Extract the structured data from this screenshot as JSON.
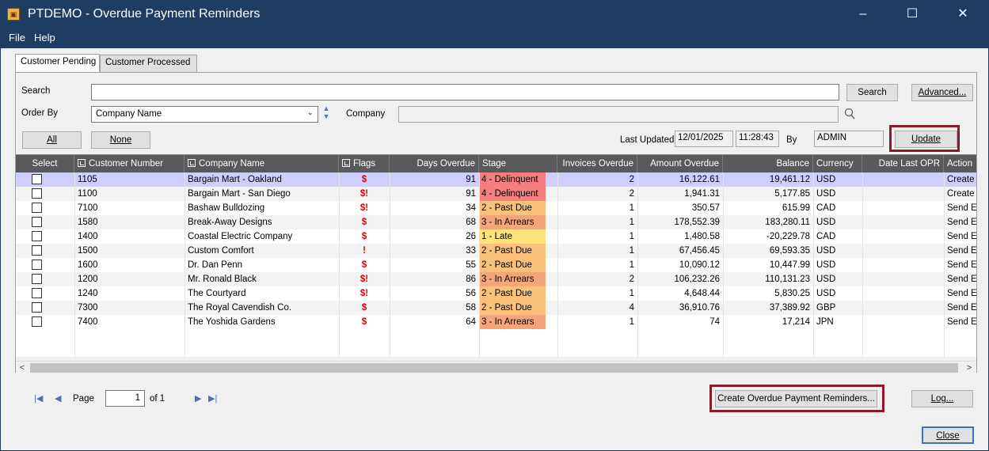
{
  "window": {
    "title": "PTDEMO - Overdue Payment Reminders"
  },
  "menu": {
    "file": "File",
    "help": "Help"
  },
  "tabs": [
    {
      "label": "Customer Pending"
    },
    {
      "label": "Customer Processed"
    }
  ],
  "search": {
    "label": "Search",
    "value": "",
    "button": "Search",
    "advanced_button": "Advanced..."
  },
  "order_by": {
    "label": "Order By",
    "selected": "Company Name"
  },
  "company": {
    "label": "Company",
    "value": ""
  },
  "select_buttons": {
    "all": "All",
    "none": "None"
  },
  "last_updated": {
    "label": "Last Updated",
    "date": "12/01/2025",
    "time": "11:28:43",
    "by_label": "By",
    "by": "ADMIN",
    "update_button": "Update"
  },
  "grid": {
    "columns": [
      "Select",
      "Customer Number",
      "Company Name",
      "Flags",
      "Days Overdue",
      "Stage",
      "Invoices Overdue",
      "Amount Overdue",
      "Balance",
      "Currency",
      "Date Last OPR",
      "Action"
    ],
    "rows": [
      {
        "cust": "1105",
        "company": "Bargain Mart - Oakland",
        "flags": "$",
        "days": "91",
        "stage": "4 - Delinquent",
        "invoices": "2",
        "amount": "16,122.61",
        "balance": "19,461.12",
        "currency": "USD",
        "date_last": "",
        "action": "Create"
      },
      {
        "cust": "1100",
        "company": "Bargain Mart - San Diego",
        "flags": "$!",
        "days": "91",
        "stage": "4 - Delinquent",
        "invoices": "2",
        "amount": "1,941.31",
        "balance": "5,177.85",
        "currency": "USD",
        "date_last": "",
        "action": "Create"
      },
      {
        "cust": "7100",
        "company": "Bashaw Bulldozing",
        "flags": "$!",
        "days": "34",
        "stage": "2 - Past Due",
        "invoices": "1",
        "amount": "350.57",
        "balance": "615.99",
        "currency": "CAD",
        "date_last": "",
        "action": "Send E"
      },
      {
        "cust": "1580",
        "company": "Break-Away Designs",
        "flags": "$",
        "days": "68",
        "stage": "3 - In Arrears",
        "invoices": "1",
        "amount": "178,552.39",
        "balance": "183,280.11",
        "currency": "USD",
        "date_last": "",
        "action": "Send E"
      },
      {
        "cust": "1400",
        "company": "Coastal Electric Company",
        "flags": "$",
        "days": "26",
        "stage": "1 - Late",
        "invoices": "1",
        "amount": "1,480.58",
        "balance": "-20,229.78",
        "currency": "CAD",
        "date_last": "",
        "action": "Send E"
      },
      {
        "cust": "1500",
        "company": "Custom Comfort",
        "flags": "!",
        "days": "33",
        "stage": "2 - Past Due",
        "invoices": "1",
        "amount": "67,456.45",
        "balance": "69,593.35",
        "currency": "USD",
        "date_last": "",
        "action": "Send E"
      },
      {
        "cust": "1600",
        "company": "Dr. Dan Penn",
        "flags": "$",
        "days": "55",
        "stage": "2 - Past Due",
        "invoices": "1",
        "amount": "10,090.12",
        "balance": "10,447.99",
        "currency": "USD",
        "date_last": "",
        "action": "Send E"
      },
      {
        "cust": "1200",
        "company": "Mr. Ronald Black",
        "flags": "$!",
        "days": "86",
        "stage": "3 - In Arrears",
        "invoices": "2",
        "amount": "106,232.26",
        "balance": "110,131.23",
        "currency": "USD",
        "date_last": "",
        "action": "Send E"
      },
      {
        "cust": "1240",
        "company": "The Courtyard",
        "flags": "$!",
        "days": "56",
        "stage": "2 - Past Due",
        "invoices": "1",
        "amount": "4,648.44",
        "balance": "5,830.25",
        "currency": "USD",
        "date_last": "",
        "action": "Send E"
      },
      {
        "cust": "7300",
        "company": "The Royal Cavendish Co.",
        "flags": "$",
        "days": "58",
        "stage": "2 - Past Due",
        "invoices": "4",
        "amount": "36,910.76",
        "balance": "37,389.92",
        "currency": "GBP",
        "date_last": "",
        "action": "Send E"
      },
      {
        "cust": "7400",
        "company": "The Yoshida Gardens",
        "flags": "$",
        "days": "64",
        "stage": "3 - In Arrears",
        "invoices": "1",
        "amount": "74",
        "balance": "17,214",
        "currency": "JPN",
        "date_last": "",
        "action": "Send E"
      }
    ]
  },
  "stage_colors": {
    "1 - Late": "#ffe27a",
    "2 - Past Due": "#f9c17a",
    "3 - In Arrears": "#f5a57a",
    "4 - Delinquent": "#f47f7f"
  },
  "pager": {
    "page_label": "Page",
    "page": "1",
    "of_label": "of 1"
  },
  "actions": {
    "create": "Create Overdue Payment Reminders...",
    "log": "Log...",
    "close": "Close"
  },
  "colors": {
    "titlebar": "#1e3d62",
    "highlight_box": "#8b1a2a",
    "selected_row": "#cfcfff"
  }
}
